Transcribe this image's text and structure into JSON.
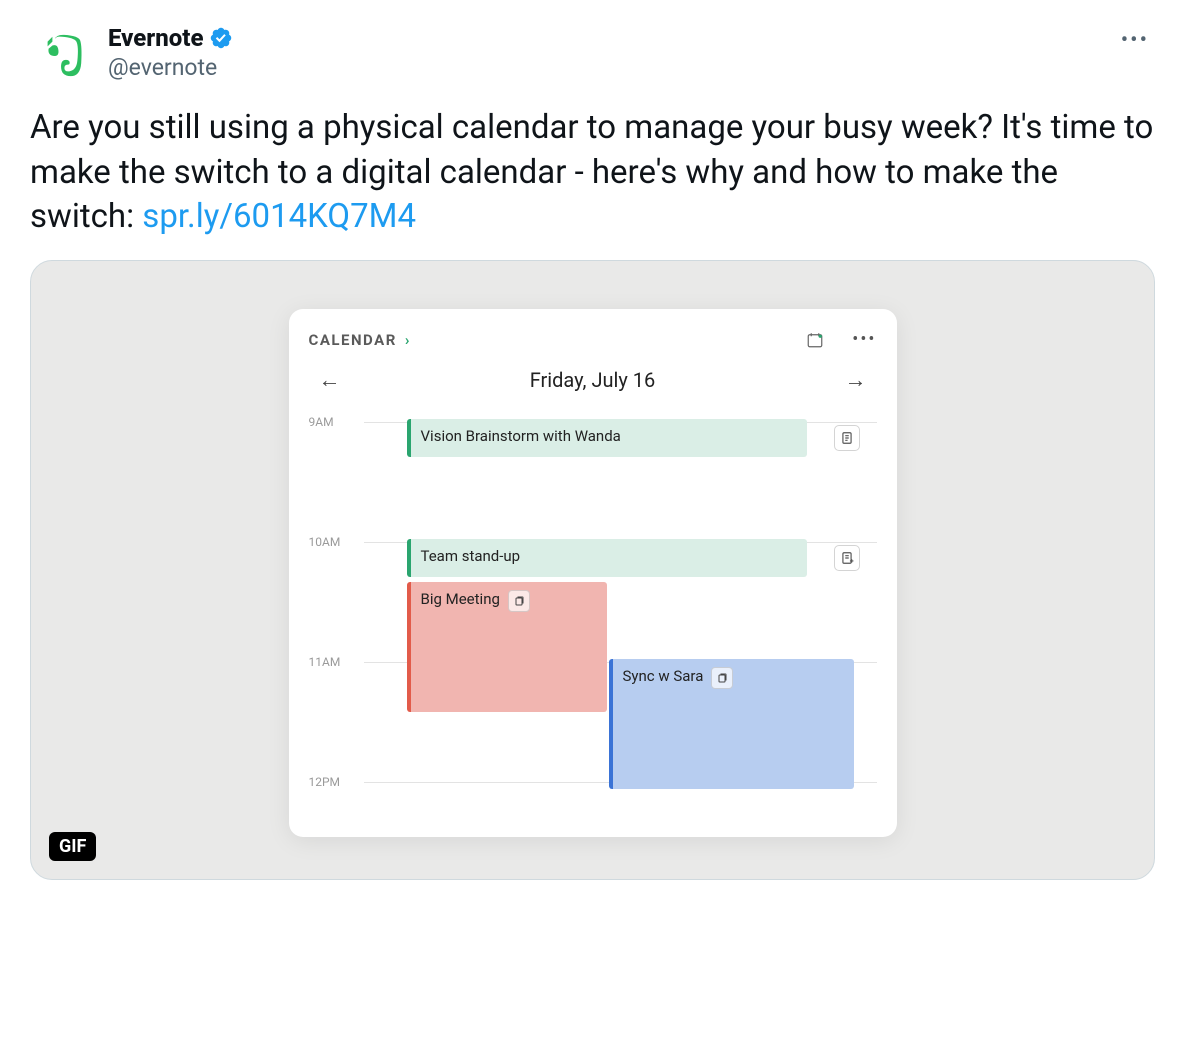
{
  "tweet": {
    "display_name": "Evernote",
    "handle": "@evernote",
    "body_text": "Are you still using a physical calendar to manage your busy week? It's time to make the switch to a digital calendar - here's why and how to make the switch: ",
    "link_text": "spr.ly/6014KQ7M4",
    "gif_badge": "GIF"
  },
  "calendar": {
    "title": "CALENDAR",
    "date": "Friday, July 16",
    "hours": [
      "9AM",
      "10AM",
      "11AM",
      "12PM"
    ],
    "events": {
      "vision": "Vision Brainstorm with Wanda",
      "standup": "Team stand-up",
      "big_meeting": "Big Meeting",
      "sync": "Sync w Sara"
    }
  }
}
